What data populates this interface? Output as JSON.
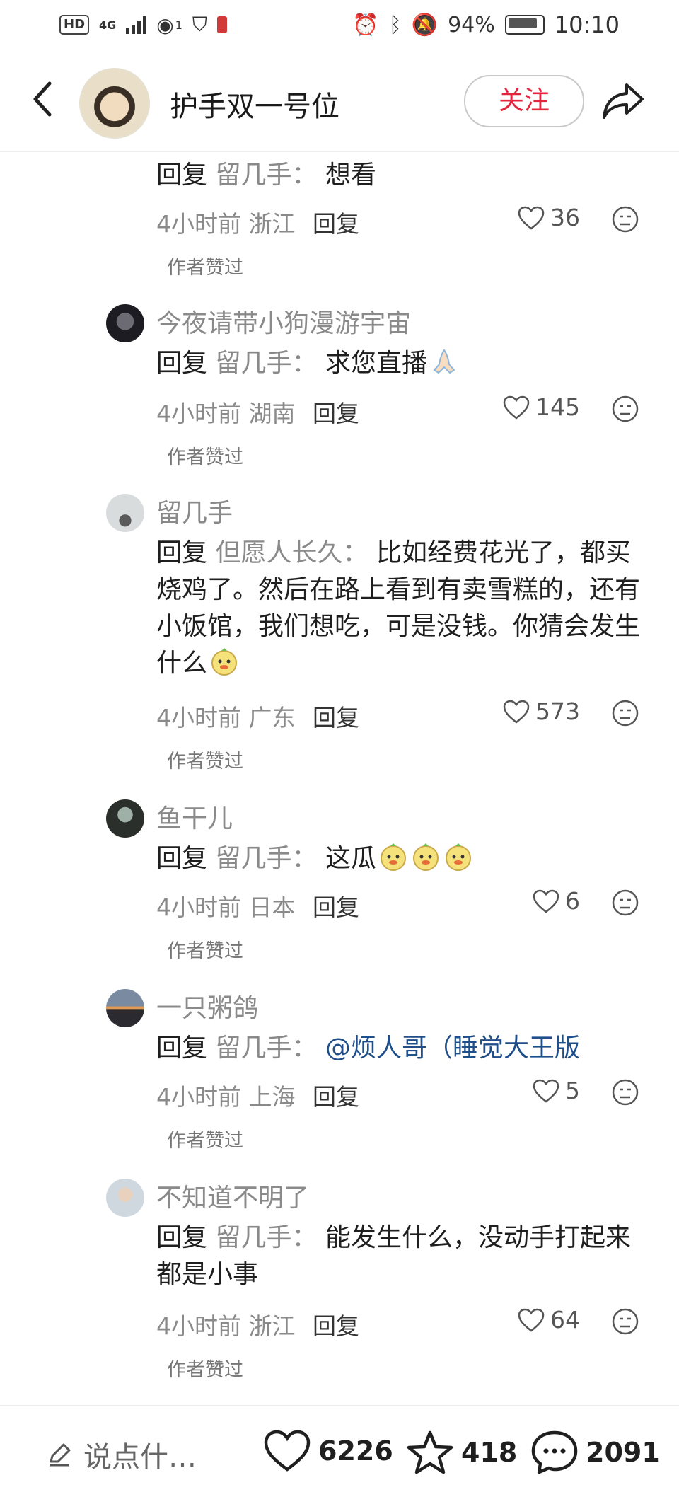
{
  "status_bar": {
    "hd": "HD",
    "network": "4G",
    "hotspot_count": "1",
    "battery": "94%",
    "time": "10:10",
    "icons": [
      "alarm-icon",
      "bluetooth-icon",
      "mute-icon"
    ]
  },
  "header": {
    "title": "护手双一号位",
    "follow_label": "关注"
  },
  "top_partial": {
    "reply_prefix": "回复",
    "reply_target": "留几手：",
    "text": "想看",
    "time": "4小时前",
    "location": "浙江",
    "reply_label": "回复",
    "likes": "36",
    "author_liked": "作者赞过"
  },
  "comments": [
    {
      "user": "今夜请带小狗漫游宇宙",
      "reply_prefix": "回复",
      "reply_target": "留几手：",
      "text": "求您直播",
      "emoji": "praying-hands",
      "time": "4小时前",
      "location": "湖南",
      "reply_label": "回复",
      "likes": "145",
      "author_liked": "作者赞过"
    },
    {
      "user": "留几手",
      "reply_prefix": "回复",
      "reply_target": "但愿人长久：",
      "text": "比如经费花光了，都买烧鸡了。然后在路上看到有卖雪糕的，还有小饭馆，我们想吃，可是没钱。你猜会发生什么",
      "emoji": "melon-face",
      "time": "4小时前",
      "location": "广东",
      "reply_label": "回复",
      "likes": "573",
      "author_liked": "作者赞过"
    },
    {
      "user": "鱼干儿",
      "reply_prefix": "回复",
      "reply_target": "留几手：",
      "text": "这瓜",
      "emoji": "melon-face x3",
      "time": "4小时前",
      "location": "日本",
      "reply_label": "回复",
      "likes": "6",
      "author_liked": "作者赞过"
    },
    {
      "user": "一只粥鸽",
      "reply_prefix": "回复",
      "reply_target": "留几手：",
      "text": "@烦人哥（睡觉大王版",
      "time": "4小时前",
      "location": "上海",
      "reply_label": "回复",
      "likes": "5",
      "author_liked": "作者赞过"
    },
    {
      "user": "不知道不明了",
      "reply_prefix": "回复",
      "reply_target": "留几手：",
      "text": "能发生什么，没动手打起来都是小事",
      "time": "4小时前",
      "location": "浙江",
      "reply_label": "回复",
      "likes": "64",
      "author_liked": "作者赞过"
    }
  ],
  "bottom_bar": {
    "input_placeholder": "说点什…",
    "likes": "6226",
    "favorites": "418",
    "comments": "2091"
  },
  "colors": {
    "follow": "#e3253e",
    "meta_gray": "#8a8a8a",
    "mention": "#1f4f8a"
  }
}
